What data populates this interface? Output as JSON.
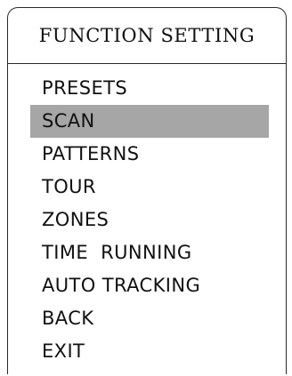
{
  "menu": {
    "title": "FUNCTION SETTING",
    "selected_index": 1,
    "items": [
      {
        "label": "PRESETS"
      },
      {
        "label": "SCAN"
      },
      {
        "label": "PATTERNS"
      },
      {
        "label": "TOUR"
      },
      {
        "label": "ZONES"
      },
      {
        "label": "TIME  RUNNING"
      },
      {
        "label": "AUTO TRACKING"
      },
      {
        "label": "BACK"
      },
      {
        "label": "EXIT"
      }
    ]
  },
  "colors": {
    "highlight": "#a6a6a6",
    "border": "#2a2a2a",
    "text": "#111111",
    "background": "#ffffff"
  }
}
